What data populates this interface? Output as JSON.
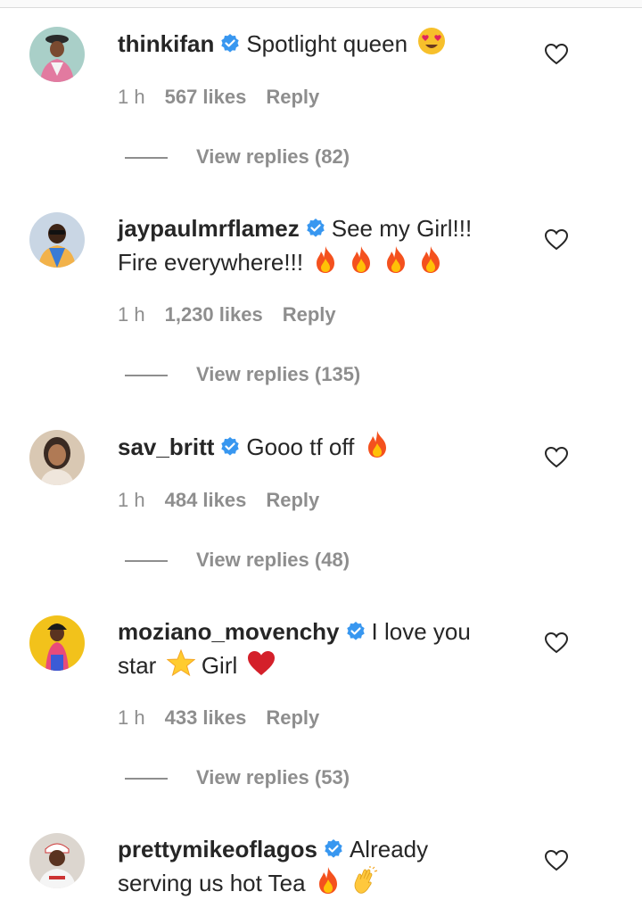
{
  "comments": [
    {
      "username": "thinkifan",
      "text": "Spotlight queen",
      "emojis": [
        "heart-eyes"
      ],
      "time": "1 h",
      "likes": "567 likes",
      "reply": "Reply",
      "view_replies": "View replies (82)"
    },
    {
      "username": "jaypaulmrflamez",
      "text": "See my Girl!!!",
      "text2": "Fire everywhere!!!",
      "emojis": [
        "fire",
        "fire",
        "fire",
        "fire"
      ],
      "time": "1 h",
      "likes": "1,230 likes",
      "reply": "Reply",
      "view_replies": "View replies (135)"
    },
    {
      "username": "sav_britt",
      "text": "Gooo tf off",
      "emojis": [
        "fire"
      ],
      "time": "1 h",
      "likes": "484 likes",
      "reply": "Reply",
      "view_replies": "View replies (48)"
    },
    {
      "username": "moziano_movenchy",
      "text": "I love you",
      "text2a": "star",
      "text2b": "Girl",
      "emojis": [
        "star",
        "red-heart"
      ],
      "time": "1 h",
      "likes": "433 likes",
      "reply": "Reply",
      "view_replies": "View replies (53)"
    },
    {
      "username": "prettymikeoflagos",
      "text": "Already",
      "text2": "serving us hot Tea",
      "emojis": [
        "fire",
        "waving-hand"
      ]
    }
  ],
  "colors": {
    "text": "#262626",
    "secondary": "#8e8e8e",
    "verified": "#3897f0"
  }
}
